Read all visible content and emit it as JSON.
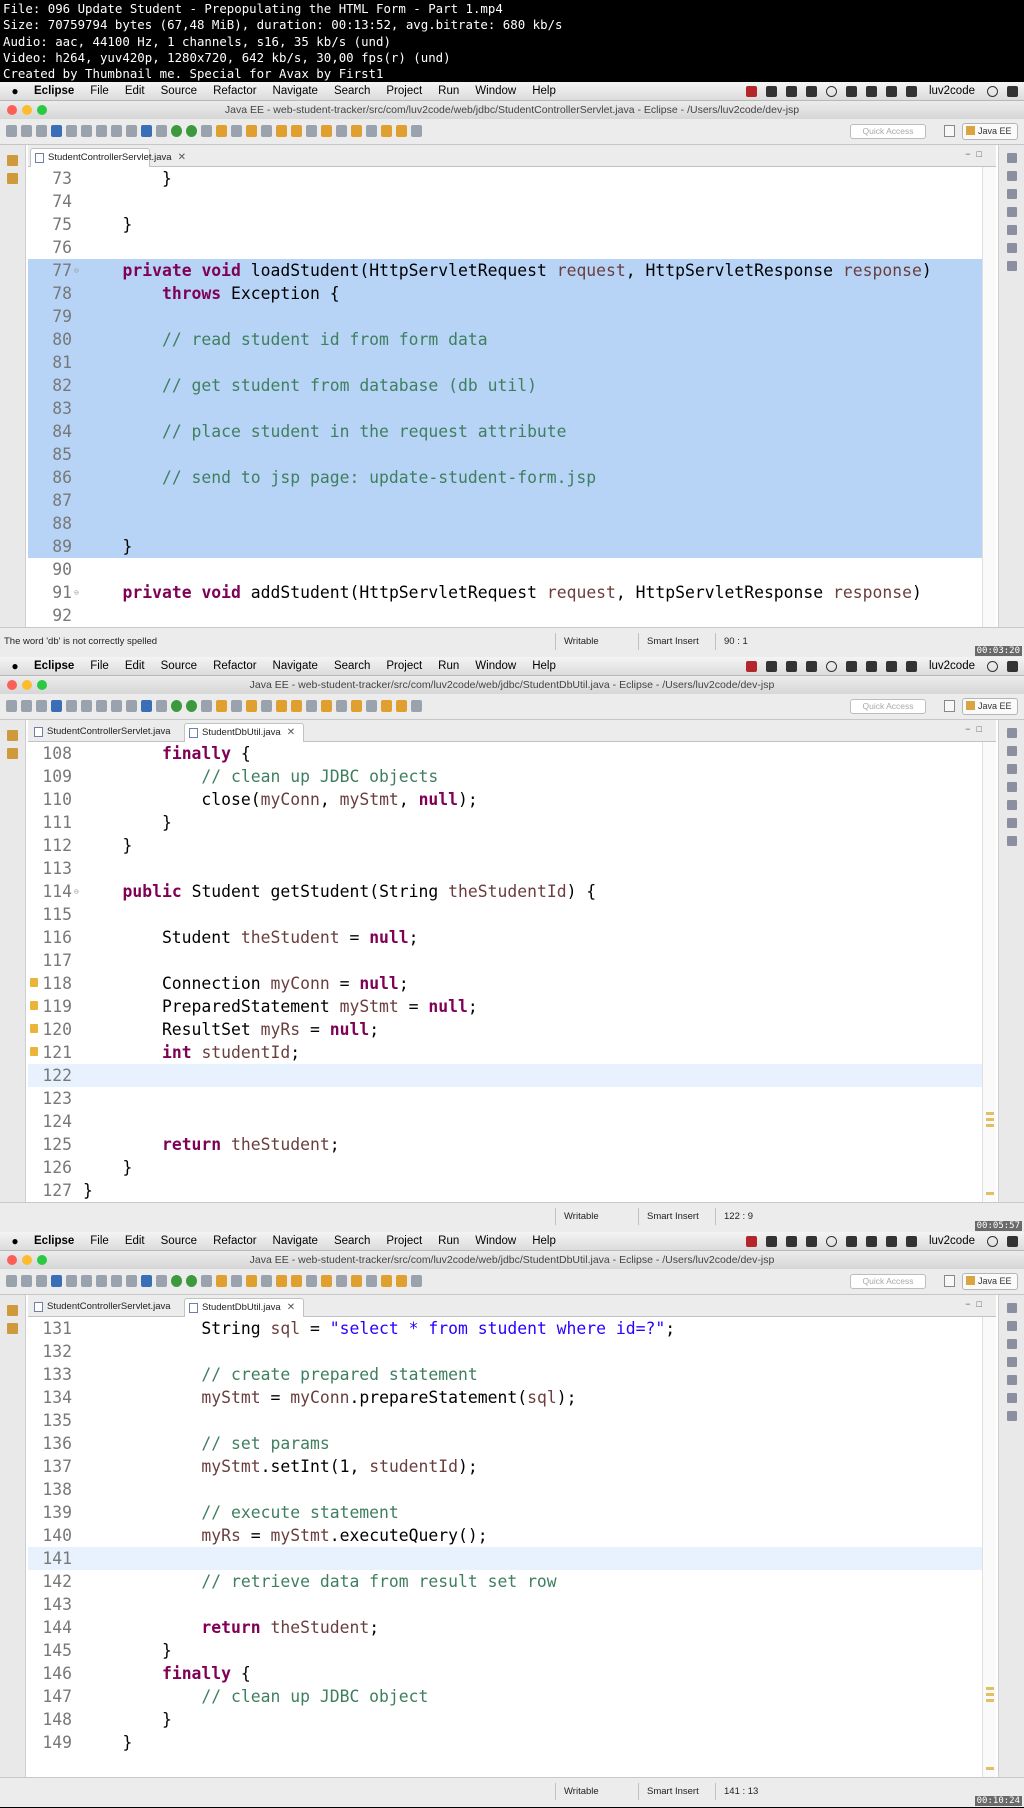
{
  "header": {
    "lines": [
      "File: 096 Update Student - Prepopulating the HTML Form - Part 1.mp4",
      "Size: 70759794 bytes (67,48 MiB), duration: 00:13:52, avg.bitrate: 680 kb/s",
      "Audio: aac, 44100 Hz, 1 channels, s16, 35 kb/s (und)",
      "Video: h264, yuv420p, 1280x720, 642 kb/s, 30,00 fps(r) (und)",
      "Created by Thumbnail me. Special for Avax by First1"
    ]
  },
  "menu": {
    "app": "Eclipse",
    "items": [
      "File",
      "Edit",
      "Source",
      "Refactor",
      "Navigate",
      "Search",
      "Project",
      "Run",
      "Window",
      "Help"
    ],
    "user": "luv2code"
  },
  "toolbar": {
    "quick_access_placeholder": "Quick Access",
    "perspective": "Java EE"
  },
  "frames": [
    {
      "window_title": "Java EE - web-student-tracker/src/com/luv2code/web/jdbc/StudentControllerServlet.java - Eclipse - /Users/luv2code/dev-jsp",
      "tabs": [
        {
          "label": "StudentControllerServlet.java",
          "active": true
        }
      ],
      "status_message": "The word 'db' is not correctly spelled",
      "status_writable": "Writable",
      "status_insert": "Smart Insert",
      "status_position": "90 : 1",
      "timestamp": "00:03:20",
      "lines": [
        {
          "n": "73",
          "code": [
            [
              "",
              "        }"
            ]
          ]
        },
        {
          "n": "74",
          "code": []
        },
        {
          "n": "75",
          "code": [
            [
              "",
              "    }"
            ]
          ]
        },
        {
          "n": "76",
          "code": []
        },
        {
          "n": "77",
          "fold": true,
          "sel": true,
          "code": [
            [
              "",
              "    "
            ],
            [
              "kw",
              "private"
            ],
            [
              "",
              " "
            ],
            [
              "kw",
              "void"
            ],
            [
              "",
              " loadStudent(HttpServletRequest "
            ],
            [
              "vr",
              "request"
            ],
            [
              "",
              ", HttpServletResponse "
            ],
            [
              "vr",
              "response"
            ],
            [
              "",
              ")"
            ]
          ]
        },
        {
          "n": "78",
          "sel": true,
          "code": [
            [
              "",
              "        "
            ],
            [
              "kw",
              "throws"
            ],
            [
              "",
              " Exception {"
            ]
          ]
        },
        {
          "n": "79",
          "sel": true,
          "code": []
        },
        {
          "n": "80",
          "sel": true,
          "code": [
            [
              "",
              "        "
            ],
            [
              "cm",
              "// read student id from form data"
            ]
          ]
        },
        {
          "n": "81",
          "sel": true,
          "code": []
        },
        {
          "n": "82",
          "sel": true,
          "code": [
            [
              "",
              "        "
            ],
            [
              "cm",
              "// get student from database (db util)"
            ]
          ]
        },
        {
          "n": "83",
          "sel": true,
          "code": []
        },
        {
          "n": "84",
          "sel": true,
          "code": [
            [
              "",
              "        "
            ],
            [
              "cm",
              "// place student in the request attribute"
            ]
          ]
        },
        {
          "n": "85",
          "sel": true,
          "code": []
        },
        {
          "n": "86",
          "sel": true,
          "code": [
            [
              "",
              "        "
            ],
            [
              "cm",
              "// send to jsp page: update-student-form.jsp"
            ]
          ]
        },
        {
          "n": "87",
          "sel": true,
          "code": []
        },
        {
          "n": "88",
          "sel": true,
          "code": []
        },
        {
          "n": "89",
          "sel": true,
          "code": [
            [
              "",
              "    }"
            ]
          ]
        },
        {
          "n": "90",
          "code": []
        },
        {
          "n": "91",
          "fold": true,
          "code": [
            [
              "",
              "    "
            ],
            [
              "kw",
              "private"
            ],
            [
              "",
              " "
            ],
            [
              "kw",
              "void"
            ],
            [
              "",
              " addStudent(HttpServletRequest "
            ],
            [
              "vr",
              "request"
            ],
            [
              "",
              ", HttpServletResponse "
            ],
            [
              "vr",
              "response"
            ],
            [
              "",
              ")"
            ]
          ]
        },
        {
          "n": "92",
          "code": []
        }
      ]
    },
    {
      "window_title": "Java EE - web-student-tracker/src/com/luv2code/web/jdbc/StudentDbUtil.java - Eclipse - /Users/luv2code/dev-jsp",
      "tabs": [
        {
          "label": "StudentControllerServlet.java",
          "active": false
        },
        {
          "label": "StudentDbUtil.java",
          "active": true
        }
      ],
      "status_message": "",
      "status_writable": "Writable",
      "status_insert": "Smart Insert",
      "status_position": "122 : 9",
      "timestamp": "00:05:57",
      "lines": [
        {
          "n": "108",
          "code": [
            [
              "",
              "        "
            ],
            [
              "kw",
              "finally"
            ],
            [
              "",
              " {"
            ]
          ]
        },
        {
          "n": "109",
          "code": [
            [
              "",
              "            "
            ],
            [
              "cm",
              "// clean up JDBC objects"
            ]
          ]
        },
        {
          "n": "110",
          "code": [
            [
              "",
              "            close("
            ],
            [
              "vr",
              "myConn"
            ],
            [
              "",
              ", "
            ],
            [
              "vr",
              "myStmt"
            ],
            [
              "",
              ", "
            ],
            [
              "kw",
              "null"
            ],
            [
              "",
              ");"
            ]
          ]
        },
        {
          "n": "111",
          "code": [
            [
              "",
              "        }"
            ]
          ]
        },
        {
          "n": "112",
          "code": [
            [
              "",
              "    }"
            ]
          ]
        },
        {
          "n": "113",
          "code": []
        },
        {
          "n": "114",
          "fold": true,
          "code": [
            [
              "",
              "    "
            ],
            [
              "kw",
              "public"
            ],
            [
              "",
              " Student getStudent(String "
            ],
            [
              "vr",
              "theStudentId"
            ],
            [
              "",
              ") {"
            ]
          ]
        },
        {
          "n": "115",
          "code": []
        },
        {
          "n": "116",
          "code": [
            [
              "",
              "        Student "
            ],
            [
              "vr",
              "theStudent"
            ],
            [
              "",
              " = "
            ],
            [
              "kw",
              "null"
            ],
            [
              "",
              ";"
            ]
          ]
        },
        {
          "n": "117",
          "code": []
        },
        {
          "n": "118",
          "warn": true,
          "code": [
            [
              "",
              "        Connection "
            ],
            [
              "vr",
              "myConn"
            ],
            [
              "",
              " = "
            ],
            [
              "kw",
              "null"
            ],
            [
              "",
              ";"
            ]
          ]
        },
        {
          "n": "119",
          "warn": true,
          "code": [
            [
              "",
              "        PreparedStatement "
            ],
            [
              "vr",
              "myStmt"
            ],
            [
              "",
              " = "
            ],
            [
              "kw",
              "null"
            ],
            [
              "",
              ";"
            ]
          ]
        },
        {
          "n": "120",
          "warn": true,
          "code": [
            [
              "",
              "        ResultSet "
            ],
            [
              "vr",
              "myRs"
            ],
            [
              "",
              " = "
            ],
            [
              "kw",
              "null"
            ],
            [
              "",
              ";"
            ]
          ]
        },
        {
          "n": "121",
          "warn": true,
          "code": [
            [
              "",
              "        "
            ],
            [
              "kw",
              "int"
            ],
            [
              "",
              " "
            ],
            [
              "vr",
              "studentId"
            ],
            [
              "",
              ";"
            ]
          ]
        },
        {
          "n": "122",
          "cur": true,
          "code": []
        },
        {
          "n": "123",
          "code": []
        },
        {
          "n": "124",
          "code": []
        },
        {
          "n": "125",
          "code": [
            [
              "",
              "        "
            ],
            [
              "kw",
              "return"
            ],
            [
              "",
              " "
            ],
            [
              "vr",
              "theStudent"
            ],
            [
              "",
              ";"
            ]
          ]
        },
        {
          "n": "126",
          "code": [
            [
              "",
              "    }"
            ]
          ]
        },
        {
          "n": "127",
          "code": [
            [
              "",
              "}"
            ]
          ]
        }
      ]
    },
    {
      "window_title": "Java EE - web-student-tracker/src/com/luv2code/web/jdbc/StudentDbUtil.java - Eclipse - /Users/luv2code/dev-jsp",
      "tabs": [
        {
          "label": "StudentControllerServlet.java",
          "active": false
        },
        {
          "label": "StudentDbUtil.java",
          "active": true
        }
      ],
      "status_message": "",
      "status_writable": "Writable",
      "status_insert": "Smart Insert",
      "status_position": "141 : 13",
      "timestamp": "00:10:24",
      "lines": [
        {
          "n": "131",
          "code": [
            [
              "",
              "            String "
            ],
            [
              "vr",
              "sql"
            ],
            [
              "",
              " = "
            ],
            [
              "st",
              "\"select * from student where id=?\""
            ],
            [
              "",
              ";"
            ]
          ]
        },
        {
          "n": "132",
          "code": []
        },
        {
          "n": "133",
          "code": [
            [
              "",
              "            "
            ],
            [
              "cm",
              "// create prepared statement"
            ]
          ]
        },
        {
          "n": "134",
          "code": [
            [
              "",
              "            "
            ],
            [
              "vr",
              "myStmt"
            ],
            [
              "",
              " = "
            ],
            [
              "vr",
              "myConn"
            ],
            [
              "",
              ".prepareStatement("
            ],
            [
              "vr",
              "sql"
            ],
            [
              "",
              ");"
            ]
          ]
        },
        {
          "n": "135",
          "code": []
        },
        {
          "n": "136",
          "code": [
            [
              "",
              "            "
            ],
            [
              "cm",
              "// set params"
            ]
          ]
        },
        {
          "n": "137",
          "code": [
            [
              "",
              "            "
            ],
            [
              "vr",
              "myStmt"
            ],
            [
              "",
              ".setInt(1, "
            ],
            [
              "vr",
              "studentId"
            ],
            [
              "",
              ");"
            ]
          ]
        },
        {
          "n": "138",
          "code": []
        },
        {
          "n": "139",
          "code": [
            [
              "",
              "            "
            ],
            [
              "cm",
              "// execute statement"
            ]
          ]
        },
        {
          "n": "140",
          "code": [
            [
              "",
              "            "
            ],
            [
              "vr",
              "myRs"
            ],
            [
              "",
              " = "
            ],
            [
              "vr",
              "myStmt"
            ],
            [
              "",
              ".executeQuery();"
            ]
          ]
        },
        {
          "n": "141",
          "cur": true,
          "code": []
        },
        {
          "n": "142",
          "code": [
            [
              "",
              "            "
            ],
            [
              "cm",
              "// retrieve data from result set row"
            ]
          ]
        },
        {
          "n": "143",
          "code": []
        },
        {
          "n": "144",
          "code": [
            [
              "",
              "            "
            ],
            [
              "kw",
              "return"
            ],
            [
              "",
              " "
            ],
            [
              "vr",
              "theStudent"
            ],
            [
              "",
              ";"
            ]
          ]
        },
        {
          "n": "145",
          "code": [
            [
              "",
              "        }"
            ]
          ]
        },
        {
          "n": "146",
          "code": [
            [
              "",
              "        "
            ],
            [
              "kw",
              "finally"
            ],
            [
              "",
              " {"
            ]
          ]
        },
        {
          "n": "147",
          "code": [
            [
              "",
              "            "
            ],
            [
              "cm",
              "// clean up JDBC object"
            ]
          ]
        },
        {
          "n": "148",
          "code": [
            [
              "",
              "        }"
            ]
          ]
        },
        {
          "n": "149",
          "code": [
            [
              "",
              "    }"
            ]
          ]
        }
      ]
    }
  ]
}
